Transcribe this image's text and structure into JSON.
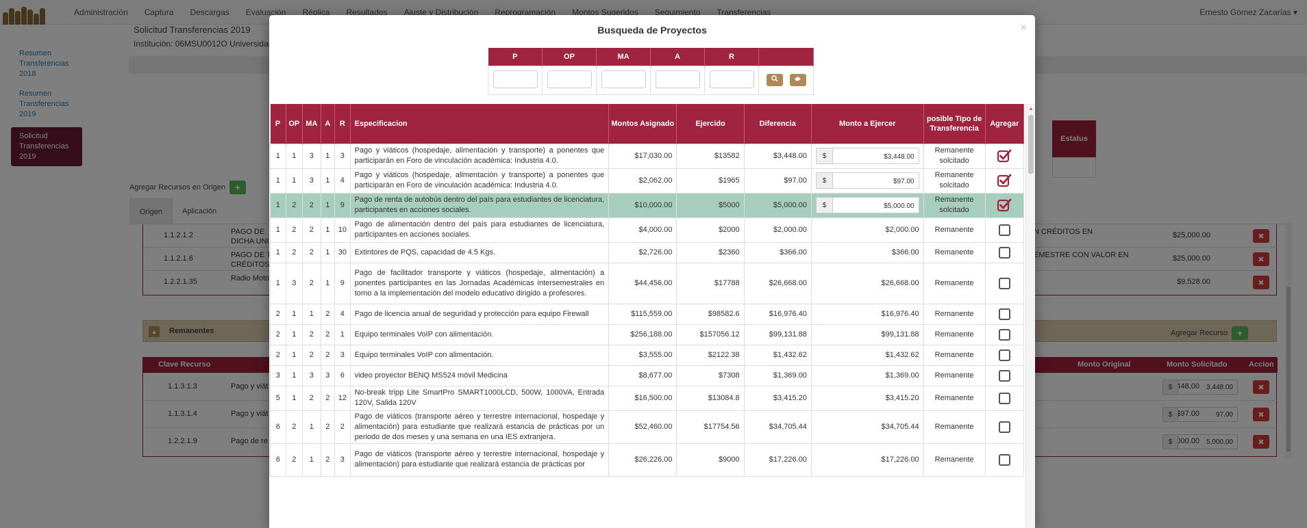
{
  "nav": {
    "items": [
      "Administración",
      "Captura",
      "Descargas",
      "Evaluación",
      "Réplica",
      "Resultados",
      "Ajuste y Distribución",
      "Reprogramación",
      "Montos Sugeridos",
      "Seguimiento",
      "Transferencias"
    ],
    "user": "Ernesto Gómez Zacarías"
  },
  "page": {
    "title": "Solicitud Transferencias 2019",
    "institution": "Institución: 06MSU0012O Universidad"
  },
  "sidebar": [
    {
      "label": "Resumen Transferencias 2018"
    },
    {
      "label": "Resumen Transferencias 2019"
    },
    {
      "label": "Solicitud Transferencias 2019"
    }
  ],
  "origin": {
    "add_label": "Agregar Recursos en Origen",
    "tabs": [
      "Origen",
      "Aplicación"
    ],
    "status_header": "Estatus",
    "rows": [
      {
        "key": "1.1.2.1.2",
        "desc": "PAGO DE DICHA UNI",
        "desc2": "N CRÉDITOS EN",
        "amount": "$25,000.00"
      },
      {
        "key": "1.1.2.1.6",
        "desc": "PAGO DE T CRÉDITOS",
        "desc2": "EMESTRE CON VALOR EN",
        "amount": "$25,000.00"
      },
      {
        "key": "1.2.2.1.35",
        "desc": "Radio Moto",
        "desc2": "",
        "amount": "$9,528.00"
      }
    ]
  },
  "remanentes": {
    "label": "Remanentes",
    "add_label": "Agregar Recurso",
    "headers": {
      "clave": "Clave Recurso",
      "original": "Monto Original",
      "solicitado": "Monto Solicitado",
      "accion": "Accion"
    },
    "rows": [
      {
        "key": "1.1.3.1.3",
        "desc": "Pago y viát",
        "original": "$3,448.00",
        "solicitado": "3,448.00"
      },
      {
        "key": "1.1.3.1.4",
        "desc": "Pago y viát",
        "original": "$97.00",
        "solicitado": "97.00"
      },
      {
        "key": "1.2.2.1.9",
        "desc": "Pago de re",
        "original": "$5,000.00",
        "solicitado": "5,000.00"
      }
    ]
  },
  "modal": {
    "title": "Busqueda de Proyectos",
    "close": "×",
    "filter_headers": [
      "P",
      "OP",
      "MA",
      "A",
      "R"
    ],
    "search_icon": "search-icon",
    "clear_icon": "eraser-icon",
    "headers": {
      "p": "P",
      "op": "OP",
      "ma": "MA",
      "a": "A",
      "r": "R",
      "spec": "Especificacion",
      "asignado": "Montos Asignado",
      "ejercido": "Ejercido",
      "diferencia": "Diferencia",
      "monto_ejercer": "Monto a Ejercer",
      "tipo": "posible Tipo de Transferencia",
      "agregar": "Agregar"
    },
    "currency": "$",
    "rows": [
      {
        "p": "1",
        "op": "1",
        "ma": "3",
        "a": "1",
        "r": "3",
        "spec": "Pago y viáticos (hospedaje, alimentación y transporte) a ponentes que participarán en Foro de vinculación académica: Industria 4.0.",
        "asignado": "$17,030.00",
        "ejercido": "$13582",
        "diferencia": "$3,448.00",
        "ejercer": "$3,448.00",
        "editable": true,
        "tipo": "Remanente solcitado",
        "checked": true,
        "selected": false
      },
      {
        "p": "1",
        "op": "1",
        "ma": "3",
        "a": "1",
        "r": "4",
        "spec": "Pago y viáticos (hospedaje, alimentación y transporte) a ponentes que participarán en Foro de vinculación académica: Industria 4.0.",
        "asignado": "$2,062.00",
        "ejercido": "$1965",
        "diferencia": "$97.00",
        "ejercer": "$97.00",
        "editable": true,
        "tipo": "Remanente solcitado",
        "checked": true,
        "selected": false
      },
      {
        "p": "1",
        "op": "2",
        "ma": "2",
        "a": "1",
        "r": "9",
        "spec": "Pago de renta de autobús dentro del país para estudiantes de licenciatura, participantes en acciones sociales.",
        "asignado": "$10,000.00",
        "ejercido": "$5000",
        "diferencia": "$5,000.00",
        "ejercer": "$5,000.00",
        "editable": true,
        "tipo": "Remanente solcitado",
        "checked": true,
        "selected": true
      },
      {
        "p": "1",
        "op": "2",
        "ma": "2",
        "a": "1",
        "r": "10",
        "spec": "Pago de alimentación dentro del país para estudiantes de licenciatura, participantes en acciones sociales.",
        "asignado": "$4,000.00",
        "ejercido": "$2000",
        "diferencia": "$2,000.00",
        "ejercer": "$2,000.00",
        "editable": false,
        "tipo": "Remanente",
        "checked": false,
        "selected": false
      },
      {
        "p": "1",
        "op": "2",
        "ma": "2",
        "a": "1",
        "r": "30",
        "spec": "Extintores de PQS, capacidad de 4.5 Kgs.",
        "asignado": "$2,726.00",
        "ejercido": "$2360",
        "diferencia": "$366.00",
        "ejercer": "$366.00",
        "editable": false,
        "tipo": "Remanente",
        "checked": false,
        "selected": false
      },
      {
        "p": "1",
        "op": "3",
        "ma": "2",
        "a": "1",
        "r": "9",
        "spec": "Pago de facilitador transporte y viáticos (hospedaje, alimentación) a ponentes participantes en las Jornadas Académicas intersemestrales en torno a la implementación del modelo educativo dirigido a profesores.",
        "asignado": "$44,456.00",
        "ejercido": "$17788",
        "diferencia": "$26,668.00",
        "ejercer": "$26,668.00",
        "editable": false,
        "tipo": "Remanente",
        "checked": false,
        "selected": false
      },
      {
        "p": "2",
        "op": "1",
        "ma": "1",
        "a": "2",
        "r": "4",
        "spec": "Pago de licencia anual de seguridad y protección para equipo Firewall",
        "asignado": "$115,559.00",
        "ejercido": "$98582.6",
        "diferencia": "$16,976.40",
        "ejercer": "$16,976.40",
        "editable": false,
        "tipo": "Remanente",
        "checked": false,
        "selected": false
      },
      {
        "p": "2",
        "op": "1",
        "ma": "2",
        "a": "2",
        "r": "1",
        "spec": "Equipo terminales VoIP con alimentación.",
        "asignado": "$256,188.00",
        "ejercido": "$157056.12",
        "diferencia": "$99,131.88",
        "ejercer": "$99,131.88",
        "editable": false,
        "tipo": "Remanente",
        "checked": false,
        "selected": false
      },
      {
        "p": "2",
        "op": "1",
        "ma": "2",
        "a": "2",
        "r": "3",
        "spec": "Equipo terminales VoIP con alimentación.",
        "asignado": "$3,555.00",
        "ejercido": "$2122.38",
        "diferencia": "$1,432.62",
        "ejercer": "$1,432.62",
        "editable": false,
        "tipo": "Remanente",
        "checked": false,
        "selected": false
      },
      {
        "p": "3",
        "op": "1",
        "ma": "3",
        "a": "3",
        "r": "6",
        "spec": "video proyector BENQ MS524 móvil Medicina",
        "asignado": "$8,677.00",
        "ejercido": "$7308",
        "diferencia": "$1,369.00",
        "ejercer": "$1,369.00",
        "editable": false,
        "tipo": "Remanente",
        "checked": false,
        "selected": false
      },
      {
        "p": "5",
        "op": "1",
        "ma": "2",
        "a": "2",
        "r": "12",
        "spec": "No-break tripp Lite SmartPro SMART1000LCD, 500W, 1000VA, Entrada 120V, Salida 120V",
        "asignado": "$16,500.00",
        "ejercido": "$13084.8",
        "diferencia": "$3,415.20",
        "ejercer": "$3,415.20",
        "editable": false,
        "tipo": "Remanente",
        "checked": false,
        "selected": false
      },
      {
        "p": "6",
        "op": "2",
        "ma": "1",
        "a": "2",
        "r": "2",
        "spec": "Pago de viáticos (transporte aéreo y terrestre internacional, hospedaje y alimentación) para estudiante que realizará estancia de prácticas por un periodo de dos meses y una semana en una IES extranjera.",
        "asignado": "$52,460.00",
        "ejercido": "$17754.56",
        "diferencia": "$34,705.44",
        "ejercer": "$34,705.44",
        "editable": false,
        "tipo": "Remanente",
        "checked": false,
        "selected": false
      },
      {
        "p": "6",
        "op": "2",
        "ma": "1",
        "a": "2",
        "r": "3",
        "spec": "Pago de viáticos (transporte aéreo y terrestre internacional, hospedaje y alimentación) para estudiante que realizará estancia de prácticas por",
        "asignado": "$26,226.00",
        "ejercido": "$9000",
        "diferencia": "$17,226.00",
        "ejercer": "$17,226.00",
        "editable": false,
        "tipo": "Remanente",
        "checked": false,
        "selected": false
      }
    ]
  }
}
